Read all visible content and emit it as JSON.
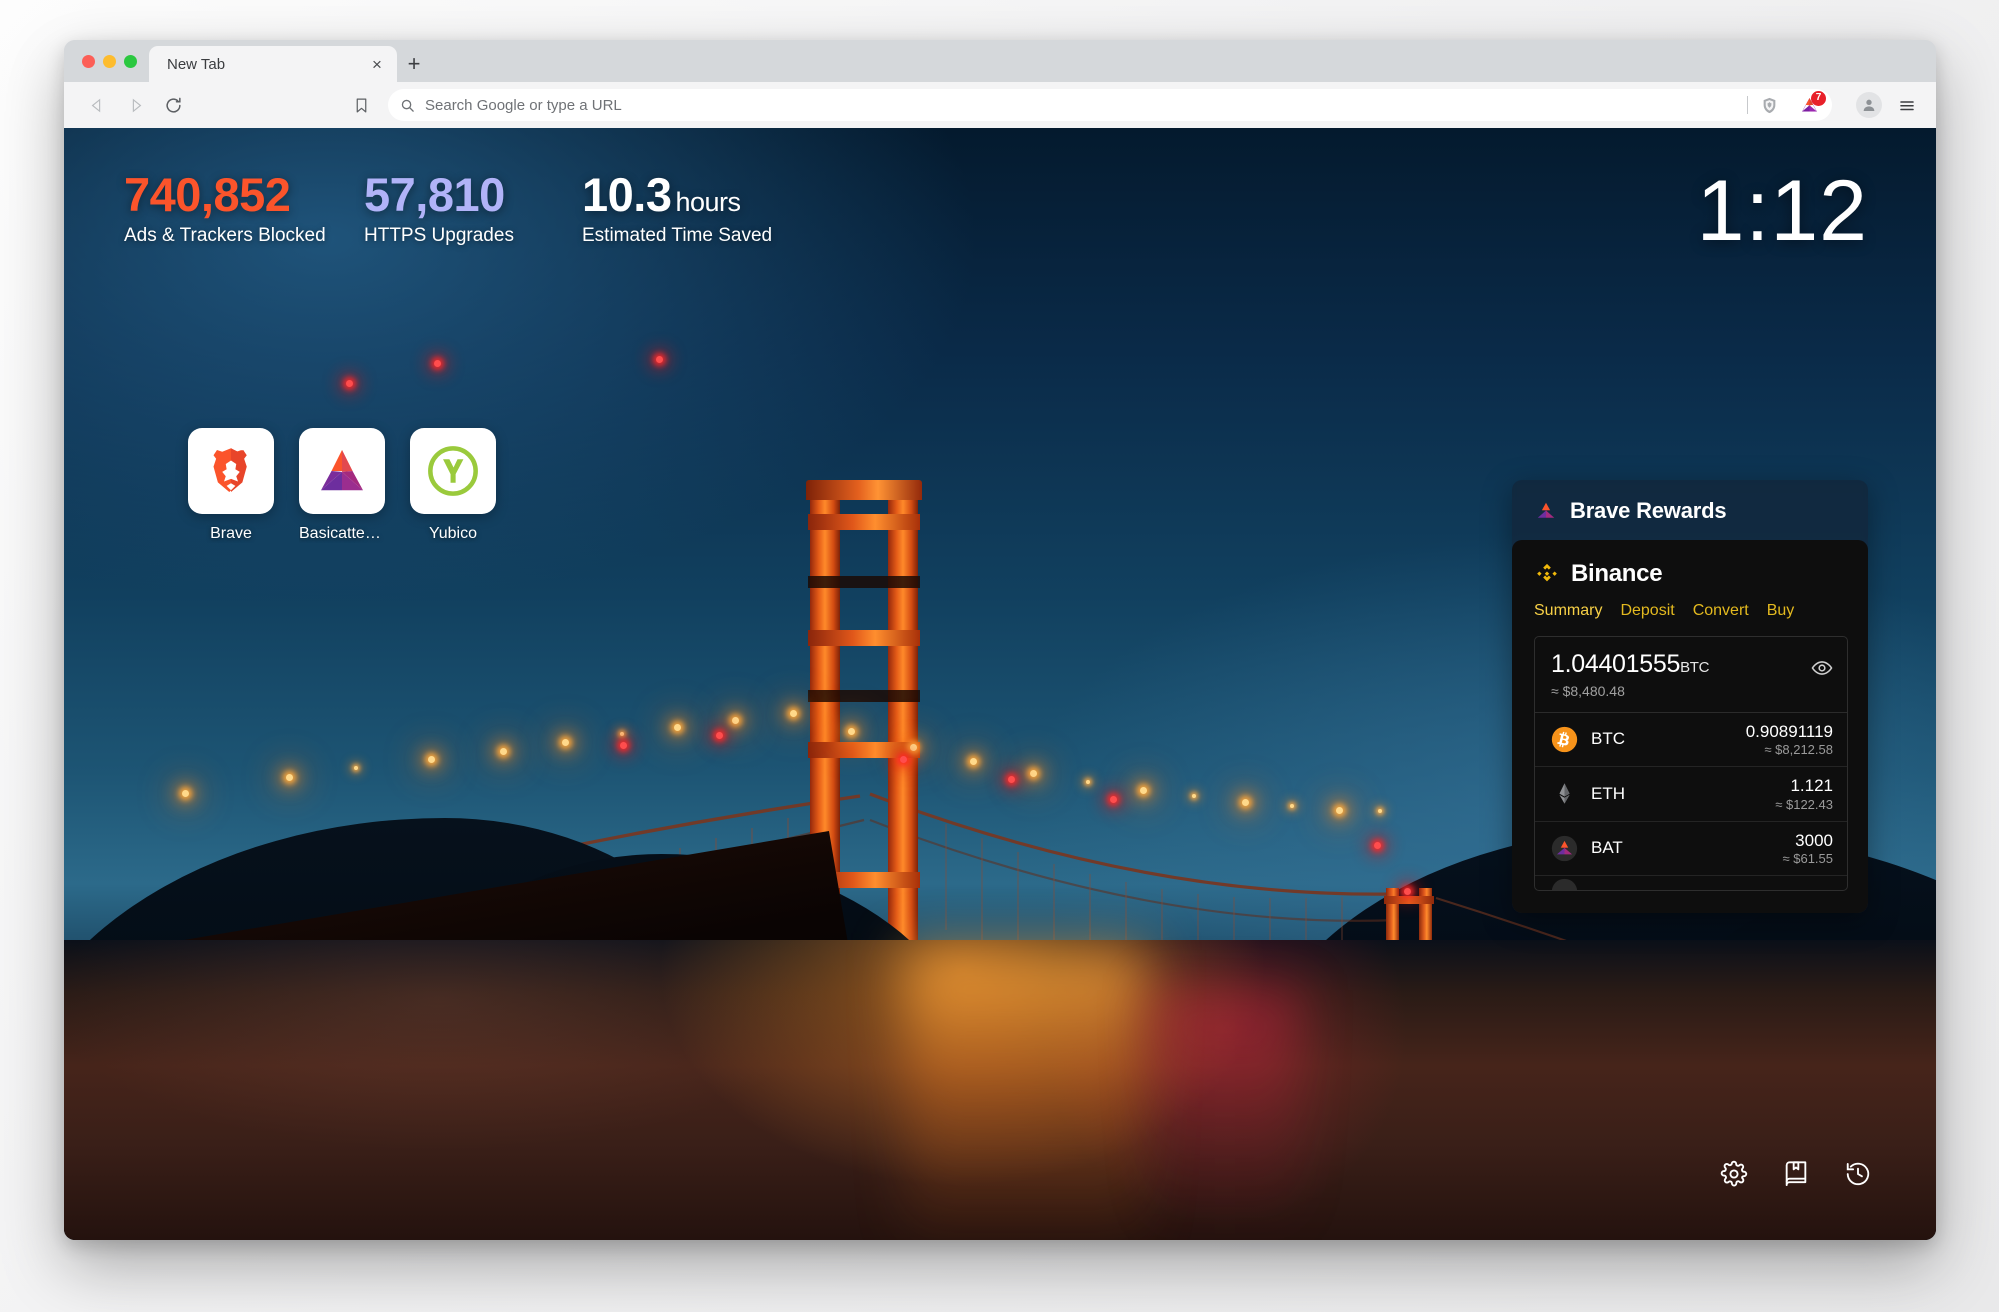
{
  "window": {
    "traffic_lights": [
      "close",
      "minimize",
      "zoom"
    ]
  },
  "tabs": {
    "items": [
      {
        "title": "New Tab",
        "active": true,
        "close_label": "×"
      }
    ],
    "new_tab_label": "+"
  },
  "toolbar": {
    "back_label": "◁",
    "forward_label": "▷",
    "reload_label": "↻",
    "bookmark_icon": "bookmark-icon",
    "omnibox": {
      "placeholder": "Search Google or type a URL",
      "value": "",
      "search_icon": "search-icon"
    },
    "shields_icon": "brave-shields-icon",
    "rewards_icon": "bat-rewards-icon",
    "rewards_badge": "7",
    "profile_icon": "profile-avatar-icon",
    "menu_icon": "hamburger-menu-icon"
  },
  "ntp": {
    "stats": [
      {
        "value": "740,852",
        "label": "Ads & Trackers Blocked",
        "color": "#fb542b",
        "suffix": ""
      },
      {
        "value": "57,810",
        "label": "HTTPS Upgrades",
        "color": "#b1b3f8",
        "suffix": ""
      },
      {
        "value": "10.3",
        "label": "Estimated Time Saved",
        "color": "#ffffff",
        "suffix": "hours"
      }
    ],
    "clock": "1:12",
    "tiles": [
      {
        "label": "Brave",
        "icon": "brave-lion-icon"
      },
      {
        "label": "Basicatten...",
        "icon": "bat-triangle-icon"
      },
      {
        "label": "Yubico",
        "icon": "yubico-y-icon"
      }
    ],
    "footer_icons": [
      {
        "name": "settings-gear-icon",
        "label": "Settings"
      },
      {
        "name": "bookmarks-book-icon",
        "label": "Bookmarks"
      },
      {
        "name": "history-clock-icon",
        "label": "History"
      }
    ]
  },
  "rewards": {
    "title": "Brave Rewards",
    "icon": "bat-triangle-icon",
    "binance": {
      "name": "Binance",
      "logo_icon": "binance-diamond-icon",
      "logo_color": "#f0b90b",
      "tabs": [
        {
          "label": "Summary",
          "active": true
        },
        {
          "label": "Deposit",
          "active": false
        },
        {
          "label": "Convert",
          "active": false
        },
        {
          "label": "Buy",
          "active": false
        }
      ],
      "balance": {
        "amount": "1.04401555",
        "unit": "BTC",
        "fiat": "≈ $8,480.48",
        "visibility_icon": "eye-icon"
      },
      "assets": [
        {
          "symbol": "BTC",
          "icon": "bitcoin-icon",
          "amount": "0.90891119",
          "fiat": "≈ $8,212.58"
        },
        {
          "symbol": "ETH",
          "icon": "ethereum-icon",
          "amount": "1.121",
          "fiat": "≈ $122.43"
        },
        {
          "symbol": "BAT",
          "icon": "bat-icon",
          "amount": "3000",
          "fiat": "≈ $61.55"
        }
      ]
    }
  },
  "colors": {
    "accent_orange": "#fb542b",
    "accent_purple": "#b1b3f8",
    "binance_yellow": "#f0b90b",
    "badge_red": "#e8202a"
  }
}
